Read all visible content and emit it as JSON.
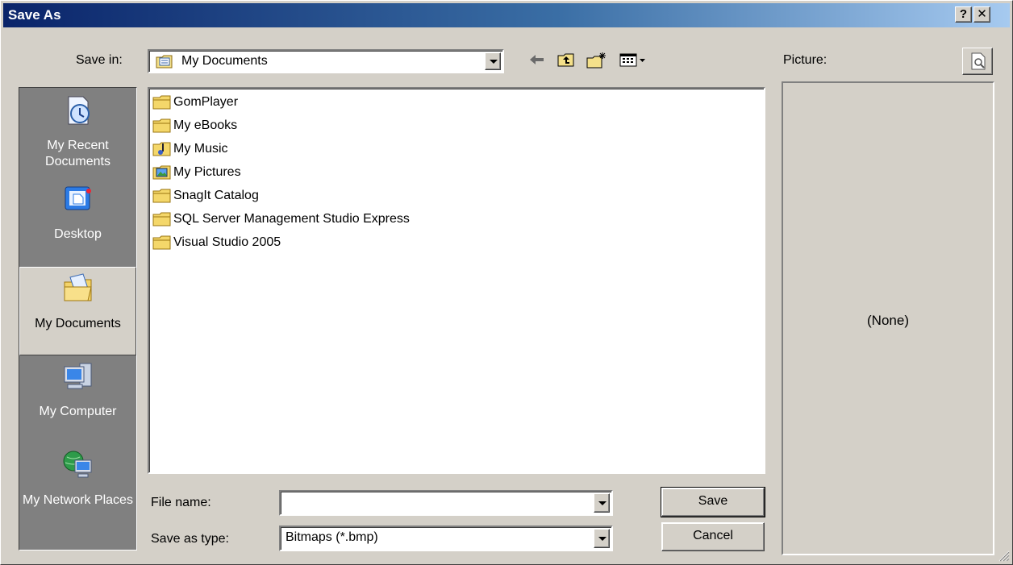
{
  "window": {
    "title": "Save As",
    "help_button": "?",
    "close_button": "✕"
  },
  "save_in": {
    "label": "Save in:",
    "value": "My Documents"
  },
  "toolbar": [
    "back-arrow-icon",
    "up-one-level-icon",
    "create-new-folder-icon",
    "view-menu-icon"
  ],
  "places": [
    {
      "label": "My Recent Documents",
      "icon": "recent-documents-icon"
    },
    {
      "label": "Desktop",
      "icon": "desktop-icon"
    },
    {
      "label": "My Documents",
      "icon": "my-documents-icon",
      "selected": true
    },
    {
      "label": "My Computer",
      "icon": "my-computer-icon"
    },
    {
      "label": "My Network Places",
      "icon": "network-places-icon"
    }
  ],
  "files": [
    {
      "name": "GomPlayer",
      "icon": "folder-icon"
    },
    {
      "name": "My eBooks",
      "icon": "folder-icon"
    },
    {
      "name": "My Music",
      "icon": "music-folder-icon"
    },
    {
      "name": "My Pictures",
      "icon": "pictures-folder-icon"
    },
    {
      "name": "SnagIt Catalog",
      "icon": "folder-icon"
    },
    {
      "name": "SQL Server Management Studio Express",
      "icon": "folder-icon"
    },
    {
      "name": "Visual Studio 2005",
      "icon": "folder-icon"
    }
  ],
  "file_name": {
    "label": "File name:",
    "value": ""
  },
  "save_as_type": {
    "label": "Save as type:",
    "value": "Bitmaps (*.bmp)"
  },
  "buttons": {
    "save": "Save",
    "cancel": "Cancel"
  },
  "preview": {
    "label": "Picture:",
    "placeholder": "(None)"
  }
}
